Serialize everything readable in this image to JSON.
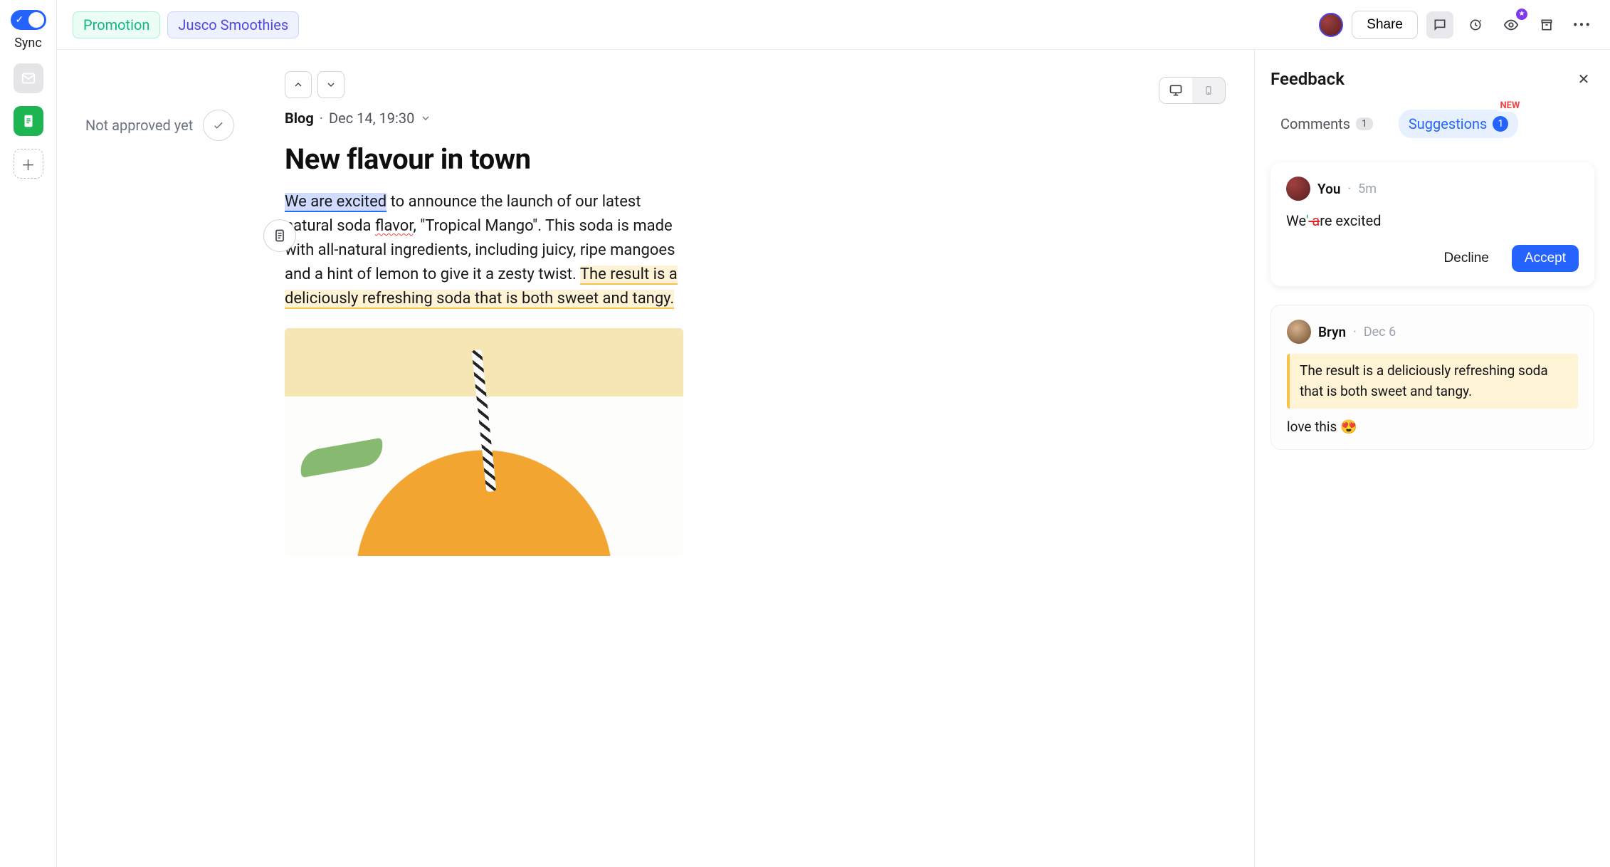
{
  "rail": {
    "sync_label": "Sync"
  },
  "topbar": {
    "tag_promotion": "Promotion",
    "tag_client": "Jusco Smoothies",
    "share": "Share"
  },
  "editor": {
    "approval": "Not approved yet",
    "meta_type": "Blog",
    "meta_date": "Dec 14, 19:30",
    "title": "New flavour in town",
    "body": {
      "hl_blue": "We are excited",
      "part1": " to announce the launch of our latest natural soda ",
      "spell": "flavor",
      "part2": ", \"Tropical Mango\". This soda is made with all-natural ingredients, including juicy, ripe mangoes and a hint of lemon to give it a zesty twist. ",
      "hl_yellow": "The result is a deliciously refreshing soda that is both sweet and tangy."
    }
  },
  "panel": {
    "title": "Feedback",
    "tabs": {
      "comments_label": "Comments",
      "comments_count": "1",
      "suggestions_label": "Suggestions",
      "suggestions_count": "1",
      "new_badge": "NEW"
    },
    "suggestion": {
      "author": "You",
      "time": "5m",
      "prefix": "We",
      "insert": "'",
      "delete": " a",
      "suffix": "re excited",
      "decline": "Decline",
      "accept": "Accept"
    },
    "comment": {
      "author": "Bryn",
      "time": "Dec 6",
      "quote": "The result is a deliciously refreshing soda that is both sweet and tangy.",
      "body": "love this 😍"
    }
  }
}
